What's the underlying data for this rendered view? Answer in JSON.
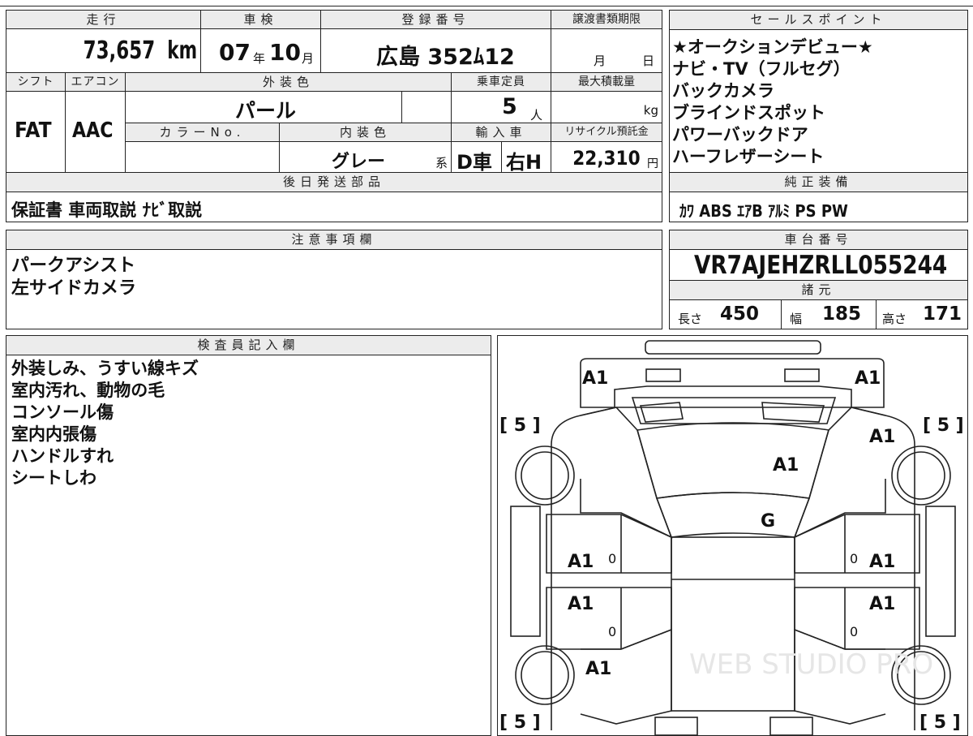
{
  "top_table": {
    "mileage_header": "走行",
    "mileage_value": "73,657",
    "mileage_unit": "km",
    "inspection_header": "車検",
    "inspection_year": "07",
    "inspection_year_unit": "年",
    "inspection_month": "10",
    "inspection_month_unit": "月",
    "registration_header": "登録番号",
    "registration_value": "広島 352ﾑ12",
    "transfer_header": "譲渡書類期限",
    "transfer_month_unit": "月",
    "transfer_day_unit": "日",
    "shift_header": "シフト",
    "shift_value": "FAT",
    "aircon_header": "エアコン",
    "aircon_value": "AAC",
    "exterior_color_header": "外装色",
    "exterior_color_value": "パール",
    "capacity_header": "乗車定員",
    "capacity_value": "5",
    "capacity_unit": "人",
    "max_load_header": "最大積載量",
    "max_load_unit": "kg",
    "color_no_header": "カラーNo.",
    "interior_color_header": "内装色",
    "interior_color_value": "グレー",
    "interior_color_suffix": "系",
    "import_header": "輸入車",
    "import_value_1": "D車",
    "import_value_2": "右H",
    "recycle_header": "リサイクル預託金",
    "recycle_value": "22,310",
    "recycle_unit": "円",
    "later_parts_header": "後日発送部品",
    "later_parts_value": "保証書 車両取説 ﾅﾋﾞ取説"
  },
  "sales_points": {
    "header": "セールスポイント",
    "items": [
      "★オークションデビュー★",
      "ナビ・TV（フルセグ）",
      "バックカメラ",
      "ブラインドスポット",
      "パワーバックドア",
      "ハーフレザーシート"
    ]
  },
  "genuine_equipment": {
    "header": "純正装備",
    "value": "ｶﾜ ABS ｴｱB ｱﾙﾐ PS PW"
  },
  "notes": {
    "header": "注意事項欄",
    "lines": [
      "パークアシスト",
      "左サイドカメラ"
    ]
  },
  "chassis": {
    "header": "車台番号",
    "value": "VR7AJEHZRLL055244"
  },
  "specs": {
    "header": "諸元",
    "length_label": "長さ",
    "length_value": "450",
    "width_label": "幅",
    "width_value": "185",
    "height_label": "高さ",
    "height_value": "171"
  },
  "inspector": {
    "header": "検査員記入欄",
    "lines": [
      "外装しみ、うすい線キズ",
      "室内汚れ、動物の毛",
      "コンソール傷",
      "室内内張傷",
      "ハンドルすれ",
      "シートしわ"
    ]
  },
  "diagram": {
    "labels": {
      "front_left": "A1",
      "front_right": "A1",
      "fender_right": "A1",
      "hood": "A1",
      "roof": "G",
      "door_fl": "A1",
      "door_fr": "A1",
      "door_rl": "A1",
      "door_rr": "A1",
      "rear_left": "A1",
      "zero_1": "0",
      "zero_2": "0",
      "zero_3": "0",
      "zero_4": "0"
    },
    "tire_tl": "[ 5 ]",
    "tire_tr": "[ 5 ]",
    "tire_bl": "[ 5 ]",
    "tire_br": "[ 5 ]",
    "watermark": "WEB STUDIO PRO"
  }
}
